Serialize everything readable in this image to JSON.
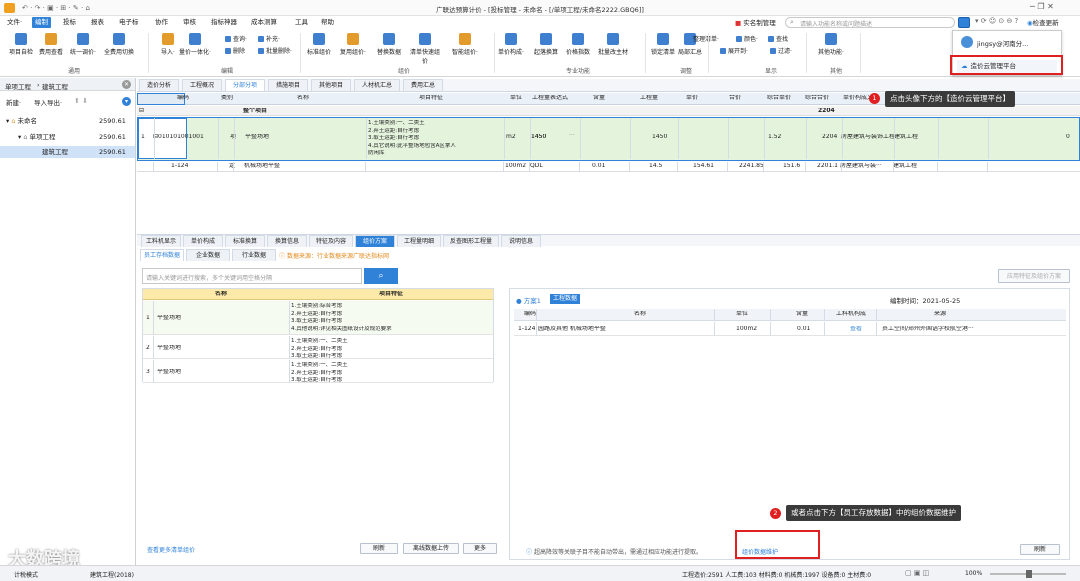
{
  "title_bar": {
    "title": "广联达预算计价 - [投标管理 - 未命名 - [/单项工程/未命名2222.GBQ6]]"
  },
  "menu": [
    "文件·",
    "编制",
    "报表",
    "报表",
    "电子标",
    "协作",
    "审核",
    "指标神器",
    "成本测算",
    "工具",
    "帮助"
  ],
  "menu_right": {
    "realname": "实名制管理",
    "search_placeholder": "请输入功能名称或问题描述",
    "check_update": "检查更新"
  },
  "ribbon": {
    "buttons": [
      {
        "label": "项目自检",
        "color": "#3f7fd0"
      },
      {
        "label": "费用查看",
        "color": "#e39b2b"
      },
      {
        "label": "统一调价·",
        "color": "#3f7fd0"
      },
      {
        "label": "全费用切换",
        "color": "#3f7fd0"
      },
      {
        "label": "导入·",
        "color": "#e39b2b"
      },
      {
        "label": "量价一体化·",
        "color": "#3f7fd0"
      },
      {
        "label": "标准组价",
        "color": "#3f7fd0"
      },
      {
        "label": "复用组价·",
        "color": "#e39b2b"
      },
      {
        "label": "替换数据",
        "color": "#3f7fd0"
      },
      {
        "label": "清单快速组价",
        "color": "#3f7fd0"
      },
      {
        "label": "智能组价·",
        "color": "#e39b2b"
      },
      {
        "label": "单价构成·",
        "color": "#3f7fd0"
      },
      {
        "label": "起落换算",
        "color": "#3f7fd0"
      },
      {
        "label": "价格指数",
        "color": "#3f7fd0"
      },
      {
        "label": "批量改主材",
        "color": "#3f7fd0"
      },
      {
        "label": "锁定清单",
        "color": "#3f7fd0"
      },
      {
        "label": "局部汇总",
        "color": "#3f7fd0"
      },
      {
        "label": "其他功能·",
        "color": "#3f7fd0"
      }
    ],
    "small": [
      "查询·",
      "删除",
      "补充·",
      "批量删除·",
      "整理清单·",
      "展开到·",
      "颜色·",
      "查找",
      "过滤·"
    ],
    "groups": [
      "通用",
      "编辑",
      "组价",
      "专业功能",
      "调整",
      "显示",
      "其他"
    ]
  },
  "user_menu": {
    "username": "jingsy@河南分...",
    "item": "造价云管理平台"
  },
  "left": {
    "tabs": [
      "单项工程",
      "建筑工程"
    ],
    "new_label": "新建·",
    "import_label": "导入导出·",
    "tree": [
      {
        "name": "未命名",
        "value": "2590.61"
      },
      {
        "name": "单项工程",
        "value": "2590.61"
      },
      {
        "name": "建筑工程",
        "value": "2590.61"
      }
    ]
  },
  "main_tabs": [
    "造价分析",
    "工程概况",
    "分部分项",
    "措施项目",
    "其他项目",
    "人材机汇总",
    "费用汇总"
  ],
  "grid": {
    "headers": [
      "编码",
      "类别",
      "名称",
      "项目特征",
      "单位",
      "工程量表达式",
      "含量",
      "工程量",
      "单价",
      "合价",
      "综合单价",
      "综合合价",
      "单价构成文件",
      "取费专业"
    ],
    "section_row": {
      "name": "整个项目",
      "total": "2204"
    },
    "row1": {
      "idx": "1",
      "code": "010101001001",
      "type": "项",
      "name": "平整场地",
      "features": [
        "1.土壤类别:一、二类土",
        "2.弃土运距:自行考虑",
        "3.取土运距:自行考虑",
        "4.其它说明:此平整场地包含A区拿人",
        "防闲库"
      ],
      "unit": "m2",
      "expr": "1450",
      "qty": "1450",
      "price": "1.52",
      "total": "2204",
      "file": "房屋建筑与装饰工程",
      "prof": "建筑工程",
      "last": "0"
    },
    "row2": {
      "code": "1-124",
      "type": "定",
      "name": "机械场地平整",
      "unit": "100m2",
      "expr": "QDL",
      "content": "0.01",
      "qty": "14.5",
      "price": "154.61",
      "total": "2241.85",
      "uprice": "151.6",
      "utotal": "2201.1",
      "file": "房屋建筑与装···",
      "prof": "建筑工程"
    }
  },
  "tooltip1": {
    "num": "1",
    "text": "点击头像下方的【造价云管理平台】"
  },
  "tooltip2": {
    "num": "2",
    "text": "或者点击下方【员工存放数据】中的组价数据维护"
  },
  "bottom_tabs": [
    "工料机显示",
    "单价构成",
    "标准换算",
    "换算信息",
    "特征及内容",
    "组价方案",
    "工程量明细",
    "反查图形工程量",
    "说明信息"
  ],
  "sub_tabs": [
    "员工存档数据",
    "企业数据",
    "行业数据"
  ],
  "source_note": "数据来源：行业数据来源广联达指标网",
  "search_placeholder": "请输入关键词进行搜索，多个关键词用空格分隔",
  "apply_btn": "应用特征及组价方案",
  "left_grid": {
    "headers": [
      "名称",
      "项目特征"
    ],
    "rows": [
      {
        "idx": "1",
        "name": "平整场地",
        "features": [
          "1.土壤类别:综合考虑",
          "2.弃土运距:自行考虑",
          "3.取土运距:自行考虑",
          "4.其他说明:详见相关图纸设计及规范要求"
        ]
      },
      {
        "idx": "2",
        "name": "平整场地",
        "features": [
          "1.土壤类别:一、二类土",
          "2.弃土运距:自行考虑",
          "3.取土运距:自行考虑"
        ]
      },
      {
        "idx": "3",
        "name": "平整场地",
        "features": [
          "1.土壤类别:一、二类土",
          "2.弃土运距:自行考虑",
          "3.取土运距:自行考虑"
        ]
      }
    ]
  },
  "left_links": {
    "more": "查看更多清单组价",
    "refresh": "刷新",
    "offline": "离线数据上传",
    "more_btn": "更多"
  },
  "right_panel": {
    "scheme": "方案1",
    "tag": "工程数据",
    "date": "编制时间：2021-05-25",
    "headers": [
      "编码",
      "名称",
      "单位",
      "含量",
      "工料机构成",
      "来源"
    ],
    "row": {
      "code": "1-124",
      "name": "园路及其他 机械场地平整",
      "unit": "100m2",
      "content": "0.01",
      "view": "查看",
      "source": "员工空间/郑州外国语学校航空港···"
    },
    "footer_note": "超高降效等关联子目不能自动带出，需通过相应功能进行提取。",
    "maintain": "组价数据维护",
    "refresh": "刷新"
  },
  "status": {
    "text": "工程造价:2591  人工费:103  材料费:0  机械费:1997  设备费:0  主材费:0",
    "zoom": "100%",
    "left1": "计税模式",
    "left2": "建筑工程(2018)"
  },
  "watermark": "大数跨境"
}
